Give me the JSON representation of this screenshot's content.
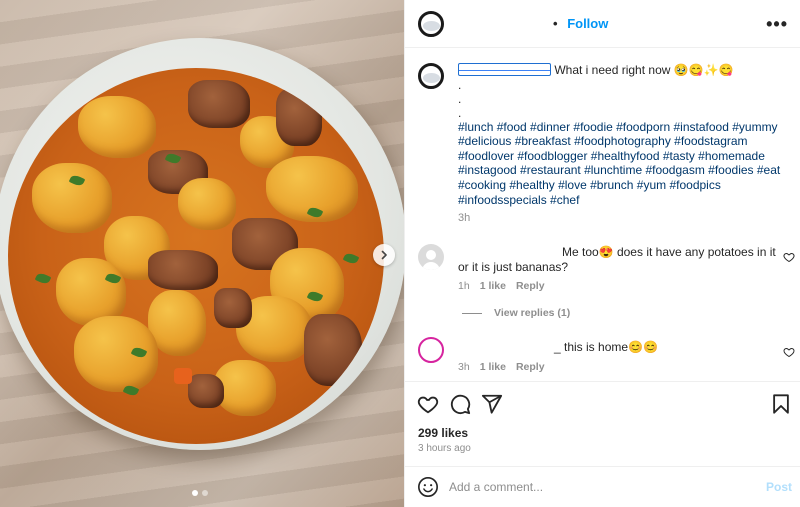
{
  "post": {
    "follow_dot": "•",
    "follow_label": "Follow",
    "more_label": "•••",
    "caption_text": "What i need right now 🥹😋✨😋",
    "caption_dots": [
      ".",
      ".",
      "."
    ],
    "hashtags": "#lunch #food #dinner #foodie #foodporn #instafood #yummy #delicious #breakfast #foodphotography #foodstagram #foodlover #foodblogger #healthyfood #tasty #homemade #instagood #restaurant #lunchtime #foodgasm #foodies #eat #cooking #healthy #love #brunch #yum #foodpics #infoodsspecials #chef",
    "caption_time": "3h"
  },
  "comments": [
    {
      "text": "Me too😍 does it have any potatoes in it or it is just bananas?",
      "time": "1h",
      "likes": "1 like",
      "reply": "Reply",
      "view_replies": "View replies (1)"
    },
    {
      "text": "_ this is home😊😊",
      "time": "3h",
      "likes": "1 like",
      "reply": "Reply"
    }
  ],
  "actions": {
    "likes": "299 likes",
    "posted": "3 hours ago"
  },
  "add_comment": {
    "placeholder": "Add a comment...",
    "post_label": "Post"
  },
  "colors": {
    "accent": "#0095f6",
    "post_disabled": "#b2dffc",
    "hashtag": "#00376b",
    "muted": "#8e8e8e"
  },
  "icons": [
    "chevron-right-icon",
    "more-icon",
    "heart-icon",
    "comment-icon",
    "share-icon",
    "bookmark-icon",
    "emoji-icon"
  ]
}
